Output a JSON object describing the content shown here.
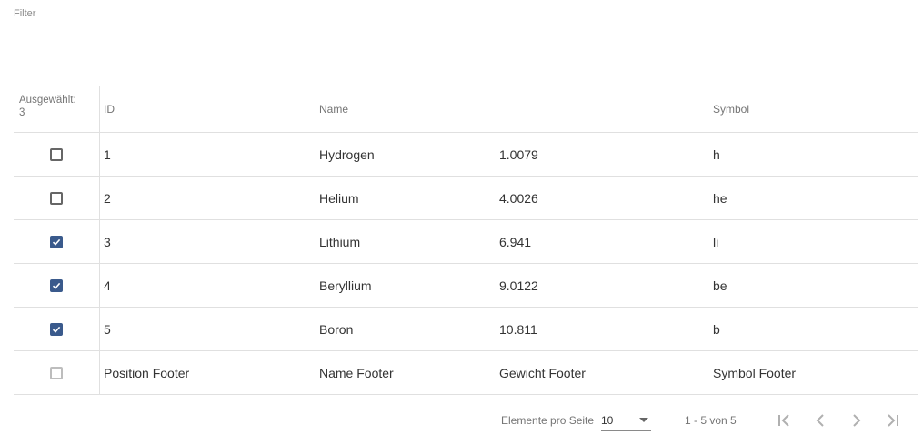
{
  "filter": {
    "label": "Filter",
    "value": ""
  },
  "table": {
    "selected_label": "Ausgewählt:",
    "selected_count": "3",
    "headers": {
      "id": "ID",
      "name": "Name",
      "weight": "",
      "symbol": "Symbol"
    },
    "rows": [
      {
        "id": "1",
        "name": "Hydrogen",
        "weight": "1.0079",
        "symbol": "h",
        "checked": false
      },
      {
        "id": "2",
        "name": "Helium",
        "weight": "4.0026",
        "symbol": "he",
        "checked": false
      },
      {
        "id": "3",
        "name": "Lithium",
        "weight": "6.941",
        "symbol": "li",
        "checked": true
      },
      {
        "id": "4",
        "name": "Beryllium",
        "weight": "9.0122",
        "symbol": "be",
        "checked": true
      },
      {
        "id": "5",
        "name": "Boron",
        "weight": "10.811",
        "symbol": "b",
        "checked": true
      }
    ],
    "footer": {
      "id": "Position Footer",
      "name": "Name Footer",
      "weight": "Gewicht Footer",
      "symbol": "Symbol Footer"
    }
  },
  "paginator": {
    "page_size_label": "Elemente pro Seite",
    "page_size": "10",
    "range_label": "1 - 5 von 5"
  },
  "colors": {
    "accent": "#3a5a8c",
    "divider": "#e0e0e0"
  },
  "icons": {
    "check": "check-icon",
    "first": "first-page-icon",
    "prev": "chevron-left-icon",
    "next": "chevron-right-icon",
    "last": "last-page-icon"
  }
}
